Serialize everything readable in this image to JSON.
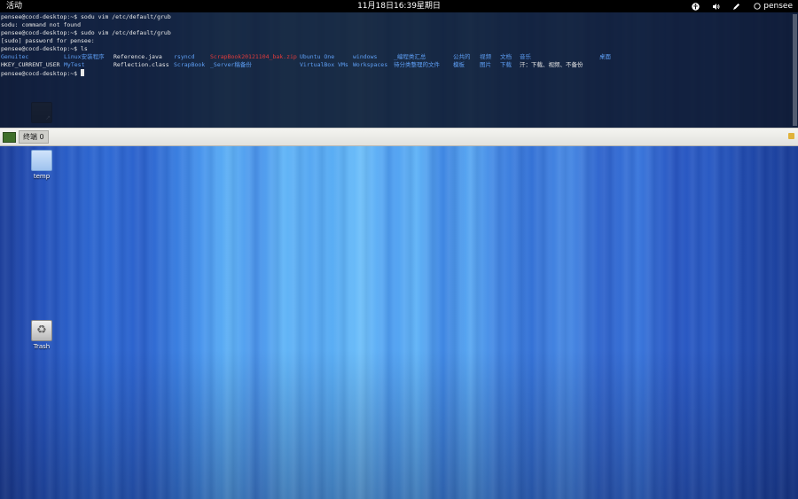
{
  "topbar": {
    "activities": "活动",
    "clock": "11月18日16:39星期日",
    "user": "pensee",
    "icons": [
      "accessibility-icon",
      "volume-icon",
      "pencil-icon",
      "user-icon"
    ]
  },
  "terminal": {
    "lines": [
      "pensee@cocd-desktop:~$ sodu vim /etc/default/grub",
      "sodu: command not found",
      "pensee@cocd-desktop:~$ sudo vim /etc/default/grub",
      "[sudo] password for pensee:",
      "pensee@cocd-desktop:~$ ls"
    ],
    "ls_row1": [
      {
        "text": "Genuitec",
        "kind": "dir"
      },
      {
        "text": "Linux安装程序",
        "kind": "dir"
      },
      {
        "text": "Reference.java",
        "kind": "file"
      },
      {
        "text": "rsyncd",
        "kind": "dir"
      },
      {
        "text": "ScrapBook20121104_bak.zip",
        "kind": "arch"
      },
      {
        "text": "Ubuntu One",
        "kind": "dir"
      },
      {
        "text": "windows",
        "kind": "dir"
      },
      {
        "text": "_编程类汇总",
        "kind": "dir"
      },
      {
        "text": "公共的",
        "kind": "dir"
      },
      {
        "text": "视频",
        "kind": "dir"
      },
      {
        "text": "文档",
        "kind": "dir"
      },
      {
        "text": "音乐",
        "kind": "dir"
      },
      {
        "text": "桌面",
        "kind": "dir"
      }
    ],
    "ls_row2": [
      {
        "text": "HKEY_CURRENT_USER",
        "kind": "file"
      },
      {
        "text": "MyTest",
        "kind": "dir"
      },
      {
        "text": "Reflection.class",
        "kind": "file"
      },
      {
        "text": "ScrapBook",
        "kind": "dir"
      },
      {
        "text": "_Server稿备份",
        "kind": "dir"
      },
      {
        "text": "VirtualBox VMs",
        "kind": "dir"
      },
      {
        "text": "Workspaces",
        "kind": "dir"
      },
      {
        "text": "待分类整理的文件",
        "kind": "dir"
      },
      {
        "text": "模板",
        "kind": "dir"
      },
      {
        "text": "图片",
        "kind": "dir"
      },
      {
        "text": "下载",
        "kind": "dir"
      },
      {
        "text": "汗：下载、视频、不备份",
        "kind": "file"
      }
    ],
    "prompt": "pensee@cocd-desktop:~$ "
  },
  "taskbar": {
    "task_label": "终端 0"
  },
  "desktop": {
    "icons": [
      {
        "label": "temp"
      },
      {
        "label": "Trash"
      }
    ]
  },
  "colors": {
    "dir": "#5e9ff5",
    "archive": "#e33b3b",
    "terminal_bg": "#0f192d"
  }
}
